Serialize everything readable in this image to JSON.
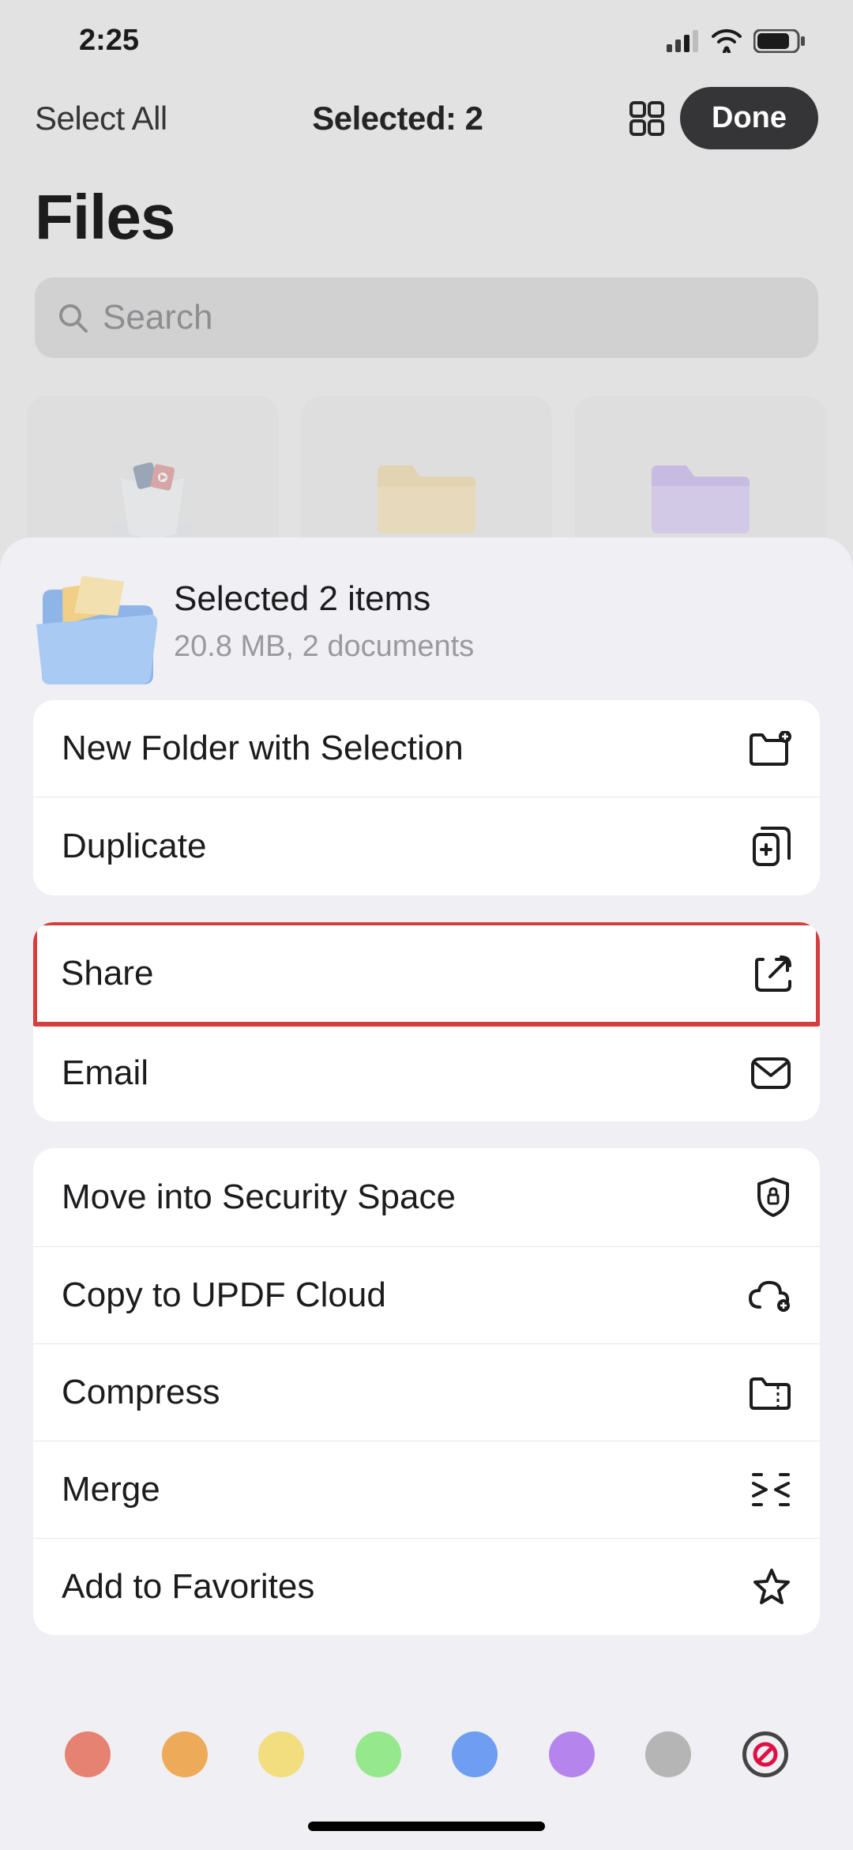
{
  "status": {
    "time": "2:25"
  },
  "toolbar": {
    "select_all": "Select All",
    "selected": "Selected: 2",
    "done": "Done"
  },
  "page": {
    "title": "Files"
  },
  "search": {
    "placeholder": "Search"
  },
  "sheet": {
    "title": "Selected 2 items",
    "subtitle": "20.8 MB, 2 documents",
    "groups": [
      [
        {
          "label": "New Folder with Selection",
          "icon": "folder-plus-icon"
        },
        {
          "label": "Duplicate",
          "icon": "duplicate-icon"
        }
      ],
      [
        {
          "label": "Share",
          "icon": "share-icon",
          "highlight": true
        },
        {
          "label": "Email",
          "icon": "mail-icon"
        }
      ],
      [
        {
          "label": "Move into Security Space",
          "icon": "shield-lock-icon"
        },
        {
          "label": "Copy to UPDF Cloud",
          "icon": "cloud-plus-icon"
        },
        {
          "label": "Compress",
          "icon": "zip-folder-icon"
        },
        {
          "label": "Merge",
          "icon": "merge-icon"
        },
        {
          "label": "Add to Favorites",
          "icon": "star-icon"
        }
      ]
    ]
  },
  "colors": [
    "#e68272",
    "#edaa58",
    "#f2dd7f",
    "#95e88b",
    "#6e9df2",
    "#b585ed",
    "#b5b5b5"
  ]
}
